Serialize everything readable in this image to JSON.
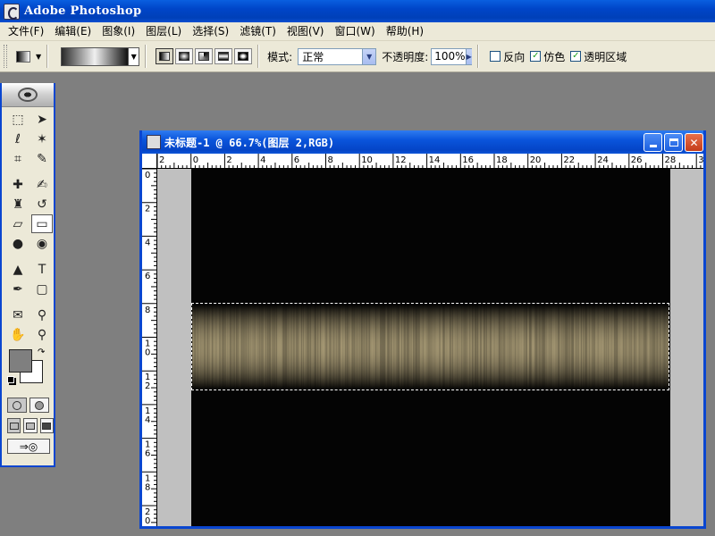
{
  "app": {
    "title": "Adobe Photoshop"
  },
  "menu": [
    {
      "label": "文件(F)",
      "name": "file"
    },
    {
      "label": "编辑(E)",
      "name": "edit"
    },
    {
      "label": "图象(I)",
      "name": "image"
    },
    {
      "label": "图层(L)",
      "name": "layer"
    },
    {
      "label": "选择(S)",
      "name": "select"
    },
    {
      "label": "滤镜(T)",
      "name": "filter"
    },
    {
      "label": "视图(V)",
      "name": "view"
    },
    {
      "label": "窗口(W)",
      "name": "window"
    },
    {
      "label": "帮助(H)",
      "name": "help"
    }
  ],
  "options": {
    "mode_label": "模式:",
    "mode_value": "正常",
    "opacity_label": "不透明度:",
    "opacity_value": "100%",
    "reverse_label": "反向",
    "reverse_checked": false,
    "dither_label": "仿色",
    "dither_checked": true,
    "transparency_label": "透明区域",
    "transparency_checked": true
  },
  "tools": [
    {
      "name": "marquee-tool",
      "glyph": "⬚",
      "active": false
    },
    {
      "name": "move-tool",
      "glyph": "➤",
      "active": false
    },
    {
      "name": "lasso-tool",
      "glyph": "ℓ",
      "active": false
    },
    {
      "name": "magic-wand-tool",
      "glyph": "✶",
      "active": false
    },
    {
      "name": "crop-tool",
      "glyph": "⌗",
      "active": false
    },
    {
      "name": "slice-tool",
      "glyph": "✎",
      "active": false
    },
    {
      "sep": true
    },
    {
      "name": "healing-brush-tool",
      "glyph": "✚",
      "active": false
    },
    {
      "name": "brush-tool",
      "glyph": "✍",
      "active": false
    },
    {
      "name": "clone-stamp-tool",
      "glyph": "♜",
      "active": false
    },
    {
      "name": "history-brush-tool",
      "glyph": "↺",
      "active": false
    },
    {
      "name": "eraser-tool",
      "glyph": "▱",
      "active": false
    },
    {
      "name": "gradient-tool",
      "glyph": "▭",
      "active": true
    },
    {
      "name": "blur-tool",
      "glyph": "●",
      "active": false
    },
    {
      "name": "dodge-tool",
      "glyph": "◉",
      "active": false
    },
    {
      "sep": true
    },
    {
      "name": "path-selection-tool",
      "glyph": "▲",
      "active": false
    },
    {
      "name": "type-tool",
      "glyph": "T",
      "active": false
    },
    {
      "name": "pen-tool",
      "glyph": "✒",
      "active": false
    },
    {
      "name": "rectangle-tool",
      "glyph": "▢",
      "active": false
    },
    {
      "sep": true
    },
    {
      "name": "notes-tool",
      "glyph": "✉",
      "active": false
    },
    {
      "name": "eyedropper-tool",
      "glyph": "⚲",
      "active": false
    },
    {
      "name": "hand-tool",
      "glyph": "✋",
      "active": false
    },
    {
      "name": "zoom-tool",
      "glyph": "⚲",
      "active": false
    }
  ],
  "colors": {
    "foreground": "#7f7f7f",
    "background": "#ffffff"
  },
  "document": {
    "title": "未标题-1 @ 66.7%(图层 2,RGB)",
    "h_ticks": [
      "2",
      "0",
      "2",
      "4",
      "6",
      "8",
      "10",
      "12",
      "14",
      "16",
      "18",
      "20",
      "22",
      "24",
      "26",
      "28",
      "3"
    ],
    "v_ticks": [
      "0",
      "2",
      "4",
      "6",
      "8",
      "1 0",
      "1 2",
      "1 4",
      "1 6",
      "1 8",
      "2 0"
    ]
  }
}
